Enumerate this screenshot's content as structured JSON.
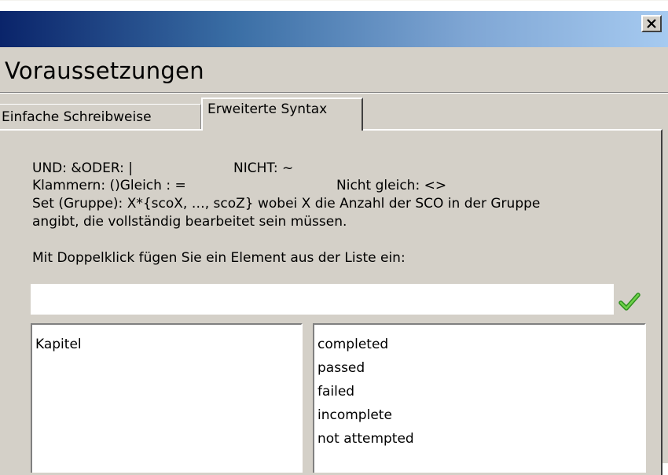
{
  "dialog": {
    "title": "Voraussetzungen",
    "close_glyph": "×"
  },
  "tabs": [
    {
      "label": "Einfache Schreibweise",
      "active": false
    },
    {
      "label": "Erweiterte Syntax",
      "active": true
    }
  ],
  "help": {
    "and_or": "UND: &ODER: |",
    "not": "NICHT: ~",
    "brackets_equal": "Klammern: ()Gleich : =",
    "not_equal": "Nicht gleich: <>",
    "set_line1": "Set (Gruppe): X*{scoX, …, scoZ} wobei X die Anzahl der SCO in der Gruppe",
    "set_line2": "angibt, die vollständig bearbeitet sein müssen.",
    "doubleclick": "Mit Doppelklick fügen Sie ein Element aus der Liste ein:"
  },
  "expression": {
    "value": "",
    "placeholder": ""
  },
  "icons": {
    "confirm": "checkmark-icon",
    "close": "close-icon"
  },
  "colors": {
    "titlebar_start": "#0a246a",
    "titlebar_end": "#a6caf0",
    "window_bg": "#d4d0c8",
    "check_green": "#3fae2a"
  },
  "list_left": {
    "items": [
      "Kapitel"
    ]
  },
  "list_right": {
    "items": [
      "completed",
      "passed",
      "failed",
      "incomplete",
      "not attempted"
    ]
  }
}
